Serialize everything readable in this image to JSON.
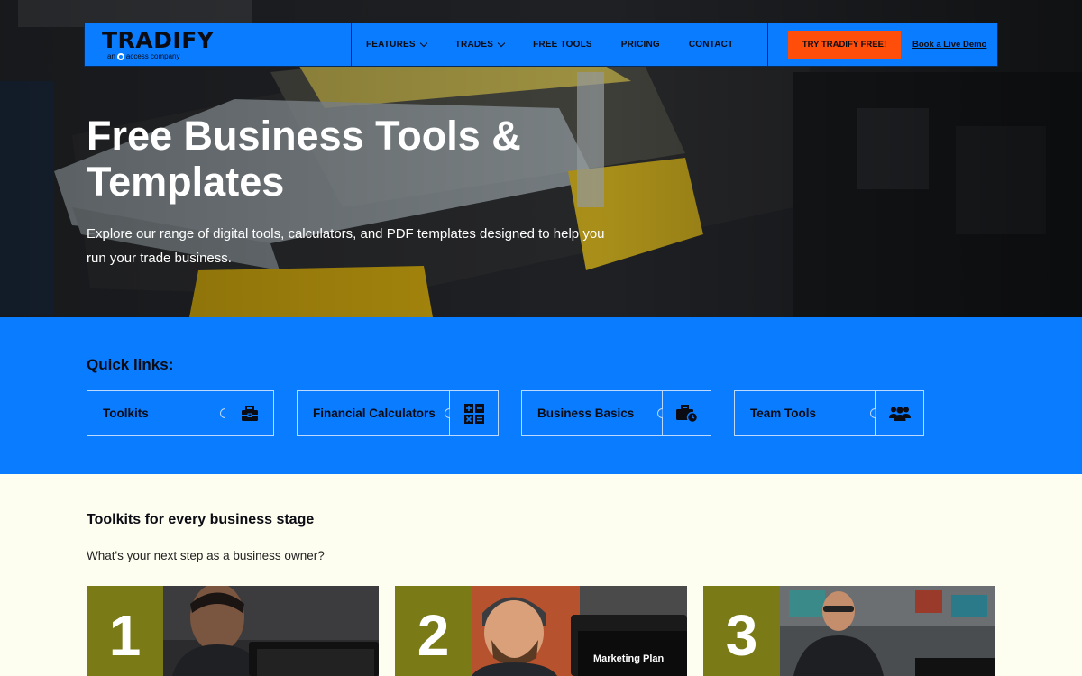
{
  "brand": {
    "name": "TRADIFY",
    "tagline_prefix": "an",
    "tagline_suffix": "access company"
  },
  "nav": {
    "links": [
      {
        "label": "FEATURES",
        "dropdown": true
      },
      {
        "label": "TRADES",
        "dropdown": true
      },
      {
        "label": "FREE TOOLS",
        "dropdown": false
      },
      {
        "label": "PRICING",
        "dropdown": false
      },
      {
        "label": "CONTACT",
        "dropdown": false
      }
    ],
    "cta_label": "TRY TRADIFY FREE!",
    "demo_label": "Book a Live Demo"
  },
  "hero": {
    "title": "Free Business Tools & Templates",
    "description": "Explore our range of digital tools, calculators, and PDF templates designed to help you run your trade business."
  },
  "quick_links": {
    "title": "Quick links:",
    "items": [
      {
        "label": "Toolkits",
        "icon": "toolbox-icon"
      },
      {
        "label": "Financial Calculators",
        "icon": "calculator-icon"
      },
      {
        "label": "Business Basics",
        "icon": "briefcase-clock-icon"
      },
      {
        "label": "Team Tools",
        "icon": "team-icon"
      }
    ]
  },
  "toolkits": {
    "title": "Toolkits for every business stage",
    "subtitle": "What's your next step as a business owner?",
    "cards": [
      {
        "number": "1",
        "caption": ""
      },
      {
        "number": "2",
        "caption": "Marketing Plan"
      },
      {
        "number": "3",
        "caption": ""
      }
    ]
  },
  "colors": {
    "primary_blue": "#0a7cff",
    "cta_orange": "#ff4d0a",
    "olive": "#7a7a16",
    "cream": "#fdfdf0"
  }
}
